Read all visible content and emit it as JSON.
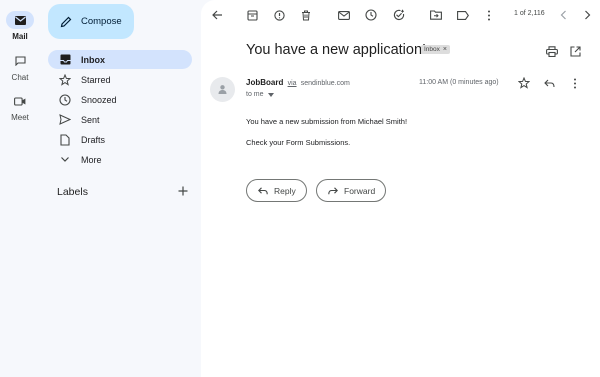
{
  "rail": [
    {
      "label": "Mail",
      "icon": "mail-icon",
      "active": true
    },
    {
      "label": "Chat",
      "icon": "chat-icon",
      "active": false
    },
    {
      "label": "Meet",
      "icon": "video-icon",
      "active": false
    }
  ],
  "compose": {
    "label": "Compose"
  },
  "nav": {
    "inbox": "Inbox",
    "starred": "Starred",
    "snoozed": "Snoozed",
    "sent": "Sent",
    "drafts": "Drafts",
    "more": "More"
  },
  "labels": {
    "heading": "Labels"
  },
  "toolbar": {
    "page_count": "1 of 2,116"
  },
  "email": {
    "subject": "You have a new application!",
    "badge": "Inbox",
    "sender_name": "JobBoard",
    "via": "via",
    "domain": "sendinblue.com",
    "to": "to me",
    "time": "11:00 AM (0 minutes ago)",
    "body": [
      "You have a new submission from Michael Smith!",
      "Check your Form Submissions."
    ]
  },
  "actions": {
    "reply": "Reply",
    "forward": "Forward"
  },
  "colors": {
    "accent": "#d3e3fd",
    "compose": "#c2e7ff",
    "bg": "#f6f8fc"
  }
}
